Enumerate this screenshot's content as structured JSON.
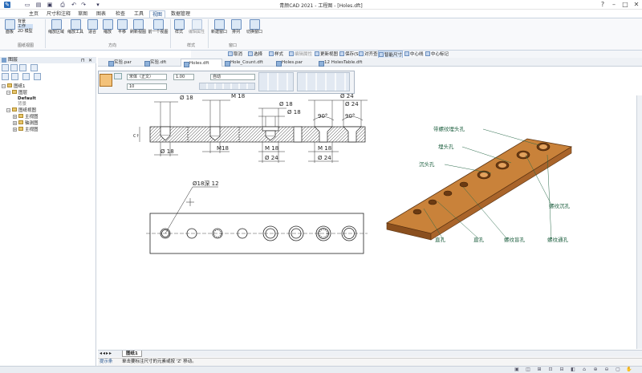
{
  "app": {
    "title": "青颜CAD 2021 - 工程图 - [Holes.dft]"
  },
  "window_controls": [
    "?",
    "–",
    "□",
    "✕"
  ],
  "ribbon_tabs": [
    "主页",
    "尺寸和注释",
    "草图",
    "图表",
    "检查",
    "工具",
    "视图",
    "数据管理"
  ],
  "active_ribbon_tab": "视图",
  "ribbon_buttons": [
    {
      "label": "面板",
      "group": "窗体"
    },
    {
      "label": "显示层",
      "group": ""
    },
    {
      "label": "缩放区域",
      "group": ""
    },
    {
      "label": "缩放工具",
      "group": ""
    },
    {
      "label": "适合",
      "group": ""
    },
    {
      "label": "缩放",
      "group": ""
    },
    {
      "label": "平移",
      "group": ""
    },
    {
      "label": "刷新视图",
      "group": ""
    },
    {
      "label": "前一个视图",
      "group": ""
    },
    {
      "label": "样式",
      "group": ""
    },
    {
      "label": "编辑属性",
      "group": ""
    },
    {
      "label": "新建窗口",
      "group": ""
    },
    {
      "label": "排列",
      "group": ""
    },
    {
      "label": "切换窗口",
      "group": ""
    }
  ],
  "ribbon_small": [
    "背景",
    "工作",
    "2D 模型"
  ],
  "ribbon_groups": [
    "图纸视图",
    "方向",
    "样式",
    "窗口"
  ],
  "command_bar": [
    {
      "label": "取消",
      "hi": false
    },
    {
      "label": "选择",
      "hi": false
    },
    {
      "label": "样式",
      "hi": false
    },
    {
      "label": "编辑属性",
      "hi": false
    },
    {
      "label": "更新视图",
      "hi": false
    },
    {
      "label": "保存(S)",
      "hi": false
    },
    {
      "label": "对齐查找",
      "hi": false
    },
    {
      "label": "智能尺寸",
      "hi": true
    },
    {
      "label": "中心线",
      "hi": false
    },
    {
      "label": "中心标记",
      "hi": false
    }
  ],
  "left_pane": {
    "title": "图层",
    "tree": [
      {
        "label": "图纸1",
        "level": 0
      },
      {
        "label": "图层",
        "level": 1
      },
      {
        "label": "Default",
        "level": 2
      },
      {
        "label": "背景",
        "level": 2
      },
      {
        "label": "图纸视图",
        "level": 1
      },
      {
        "label": "主视图",
        "level": 2
      },
      {
        "label": "轴测图",
        "level": 2
      },
      {
        "label": "主视图",
        "level": 2
      }
    ]
  },
  "doc_tabs": [
    "实验.par",
    "实验.dft",
    "Holes.dft",
    "Hole_Count.dft",
    "Holes.par",
    "12 HolesTable.dft"
  ],
  "active_doc_tab": "Holes.dft",
  "toolbox": {
    "font": "宋体（正文）",
    "size": "1.00",
    "auto": "自动",
    "height": "10"
  },
  "drawing": {
    "top_dims": [
      "Ø 18",
      "M 18",
      "Ø 18",
      "Ø 24",
      "Ø 18",
      "90°",
      "90°",
      "Ø 24"
    ],
    "bottom_dims": [
      "Ø 18",
      "M18",
      "M 18",
      "Ø 24",
      "M 18",
      "Ø 24"
    ],
    "side_label": "C↑",
    "hole_note": "Ø18深 12",
    "iso_labels": [
      "带螺纹埋头孔",
      "埋头孔",
      "沉头孔",
      "螺纹沉孔",
      "直孔",
      "直孔",
      "螺纹盲孔",
      "螺纹通孔"
    ]
  },
  "sheet_tabs": [
    "图纸1"
  ],
  "prompt": {
    "label": "提示条",
    "text": "单击要标注尺寸的元素或按 'Z' 移动。"
  },
  "colors": {
    "accent": "#1f5fa8",
    "plate_orange": "#c9823a",
    "plate_dark": "#8a4f1e"
  }
}
